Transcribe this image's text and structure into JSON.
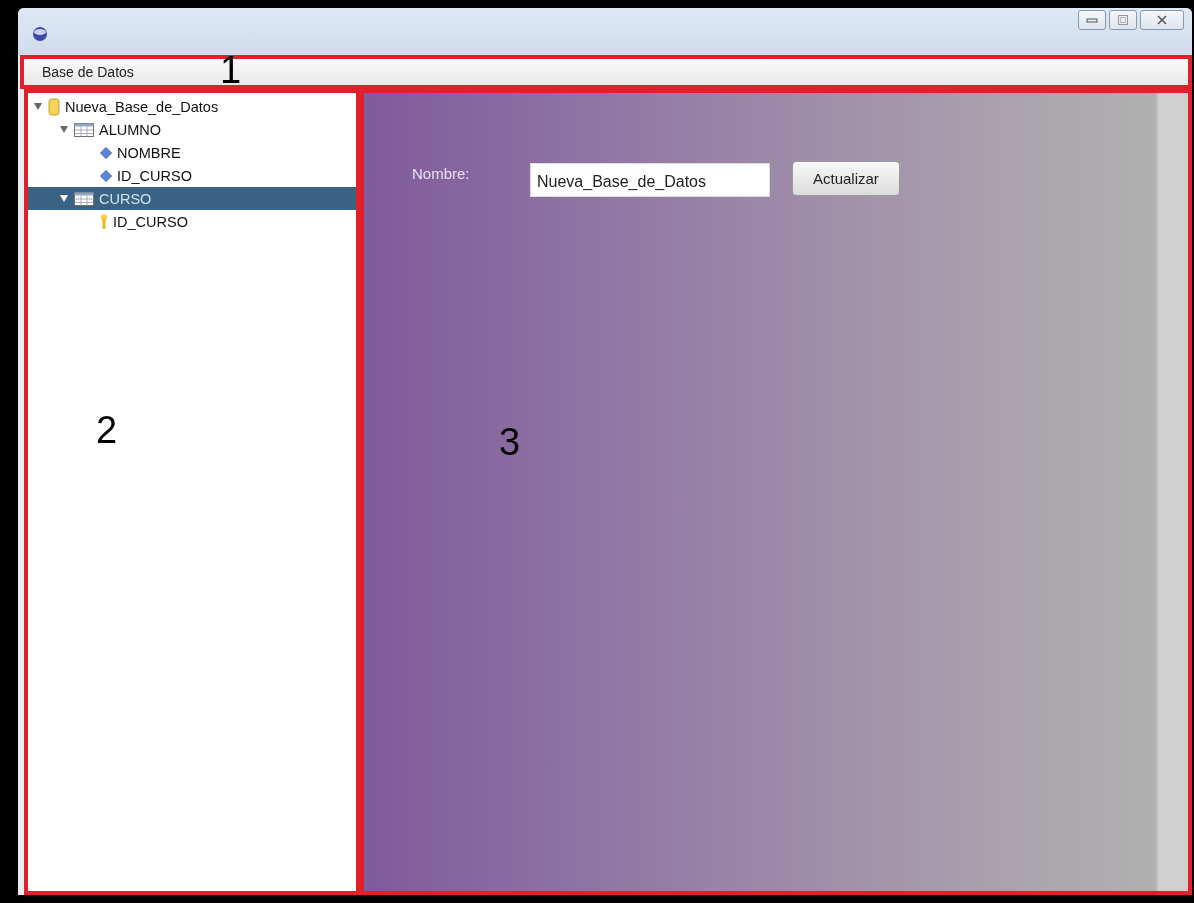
{
  "menu_bar": {
    "items": [
      {
        "label": "Base de Datos"
      }
    ]
  },
  "tree": [
    {
      "label": "Nueva_Base_de_Datos",
      "kind": "database",
      "expanded": true,
      "selected": false,
      "children": [
        {
          "label": "ALUMNO",
          "kind": "table",
          "expanded": true,
          "selected": false,
          "children": [
            {
              "label": "NOMBRE",
              "kind": "column",
              "expanded": false,
              "selected": false
            },
            {
              "label": "ID_CURSO",
              "kind": "column",
              "expanded": false,
              "selected": false
            }
          ]
        },
        {
          "label": "CURSO",
          "kind": "table",
          "expanded": true,
          "selected": true,
          "children": [
            {
              "label": "ID_CURSO",
              "kind": "key",
              "expanded": false,
              "selected": false
            }
          ]
        }
      ]
    }
  ],
  "form": {
    "label": "Nombre:",
    "field": {
      "value": "Nueva_Base_de_Datos"
    },
    "button": "Actualizar"
  },
  "annotations": [
    "1",
    "2",
    "3"
  ]
}
